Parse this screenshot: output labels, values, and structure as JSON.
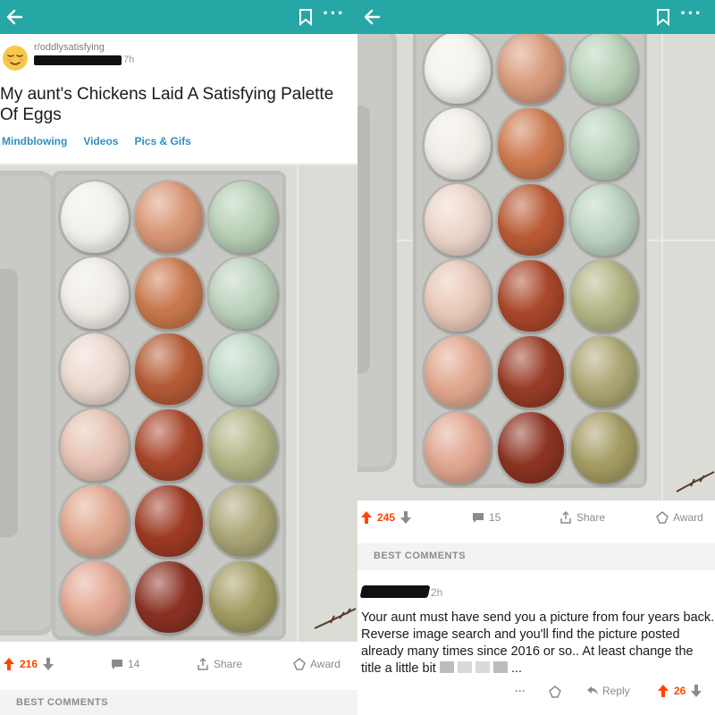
{
  "left": {
    "post": {
      "subreddit": "r/oddlysatisfying",
      "time": "7h",
      "title": "My aunt's Chickens Laid A Satisfying Palette Of Eggs",
      "flairs": [
        "Mindblowing",
        "Videos",
        "Pics & Gifs"
      ]
    },
    "actions": {
      "votes": "216",
      "comments": "14",
      "share": "Share",
      "award": "Award"
    },
    "best_comments": "BEST COMMENTS"
  },
  "right": {
    "actions": {
      "votes": "245",
      "comments": "15",
      "share": "Share",
      "award": "Award"
    },
    "best_comments": "BEST COMMENTS",
    "comment": {
      "time": "2h",
      "text": "Your aunt must have send you a picture from four years back. Reverse image search and you'll find the picture posted already many times since 2016 or so.. At least change the title a little bit",
      "trailing": "...",
      "more": "···",
      "reply": "Reply",
      "votes": "26"
    }
  },
  "colors": {
    "topbar": "#26a7a5",
    "upvote": "#ff4500",
    "flair": "#2f8fc4",
    "eggs_left": [
      [
        "#f1f0ec",
        "#d99676",
        "#b7d0b6"
      ],
      [
        "#efece6",
        "#c9784d",
        "#bcd3bd"
      ],
      [
        "#ecd9cf",
        "#b45b35",
        "#bfd6c4"
      ],
      [
        "#e7c3b4",
        "#a8462b",
        "#b3b585"
      ],
      [
        "#e1a88e",
        "#9c3a24",
        "#a9a575"
      ],
      [
        "#e3a893",
        "#8a3122",
        "#a29c62"
      ]
    ],
    "eggs_right": [
      [
        "#f3f2ee",
        "#d99a7c",
        "#b9d1b8"
      ],
      [
        "#f0ede7",
        "#cd7a50",
        "#bad2bc"
      ],
      [
        "#ecd6cb",
        "#b95a35",
        "#bcd3c0"
      ],
      [
        "#e8c8b8",
        "#a9472a",
        "#b3b584"
      ],
      [
        "#e1a78d",
        "#983c26",
        "#aca673"
      ],
      [
        "#e1a690",
        "#8c3423",
        "#a49c63"
      ]
    ]
  }
}
